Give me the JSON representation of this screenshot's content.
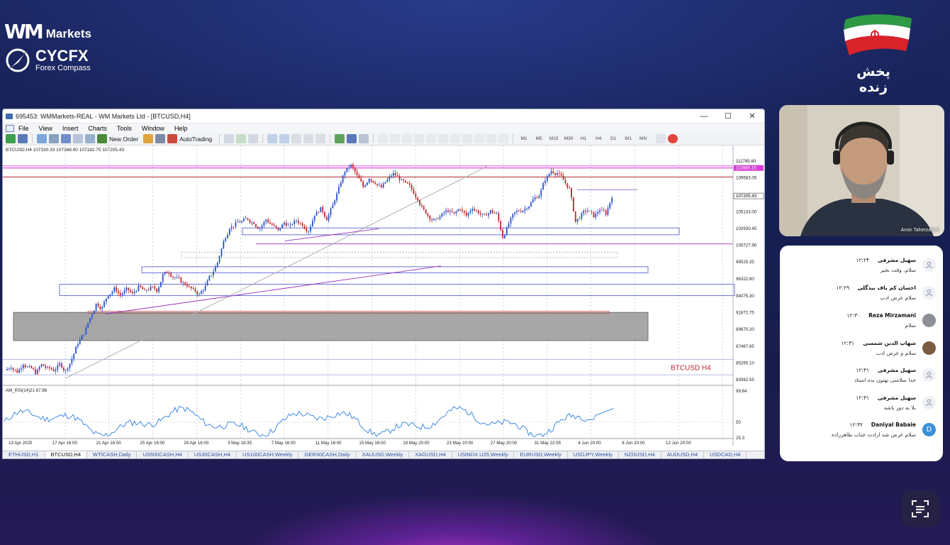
{
  "brand": {
    "wm_logo": "WM",
    "wm_markets": "Markets",
    "cycfx_title": "CYCFX",
    "cycfx_subtitle": "Forex Compass"
  },
  "live_label": "پخش زنده",
  "terminal": {
    "title": "695453: WMMarkets-REAL - WM Markets Ltd - [BTCUSD,H4]",
    "menu": [
      "File",
      "View",
      "Insert",
      "Charts",
      "Tools",
      "Window",
      "Help"
    ],
    "toolbar": {
      "new_order": "New Order",
      "autotrading": "AutoTrading",
      "timeframes": [
        "M1",
        "M5",
        "M15",
        "M30",
        "H1",
        "H4",
        "D1",
        "W1",
        "MN"
      ]
    },
    "chart_header": "BTCUSD,H4  107330.33 107368.90 107182.75 107205.43",
    "symbol_label": "BTCUSD H4",
    "rsi_label": "AM_RSI(14)21 67.98",
    "tabs": [
      "ETHUSD,H1",
      "BTCUSD,H4",
      "WTICASH,Daily",
      "US500CASH,H4",
      "US30CASH,H4",
      "US100CASH,Weekly",
      "GER30CASH,Daily",
      "XAUUSD,Weekly",
      "XAGUSD,H4",
      "USINDX.U25,Weekly",
      "EURUSD,Weekly",
      "USDJPY,Weekly",
      "NZDUSD,H4",
      "AUDUSD,H4",
      "USDCAD,H4"
    ],
    "active_tab": "BTCUSD,H4"
  },
  "chart_data": {
    "type": "candlestick",
    "symbol": "BTCUSD",
    "timeframe": "H4",
    "y_ticks": [
      111785.6,
      109583.05,
      107205.43,
      105133.0,
      102930.45,
      100727.9,
      98525.35,
      96322.8,
      94075.3,
      91872.75,
      89670.2,
      87467.65,
      85265.1,
      83062.55
    ],
    "current_price": 107205.43,
    "highlight_price": 110880.15,
    "x_ticks": [
      "13 Apr 2025",
      "17 Apr 16:00",
      "21 Apr 16:00",
      "25 Apr 16:00",
      "29 Apr 16:00",
      "3 May 18:35",
      "7 May 16:00",
      "11 May 16:00",
      "15 May 16:00",
      "19 May 20:00",
      "23 May 20:00",
      "27 May 20:00",
      "31 May 22:55",
      "4 Jun 20:00",
      "8 Jun 20:00",
      "12 Jun 20:00"
    ],
    "price_path": [
      84300,
      84800,
      84100,
      85200,
      84600,
      84000,
      85000,
      84500,
      84300,
      85100,
      84200,
      85800,
      87900,
      89200,
      91200,
      93000,
      92500,
      94300,
      95000,
      94200,
      94900,
      94300,
      95200,
      94600,
      95100,
      94800,
      96800,
      97200,
      96500,
      96000,
      95500,
      94800,
      94200,
      95300,
      96900,
      98500,
      101200,
      103100,
      103500,
      103800,
      104200,
      103700,
      103000,
      104100,
      103400,
      102600,
      103700,
      103200,
      104000,
      103500,
      102700,
      104800,
      105500,
      104200,
      106000,
      108200,
      110500,
      111200,
      109800,
      108400,
      109600,
      109000,
      108300,
      109300,
      110100,
      109500,
      108800,
      108100,
      106900,
      105300,
      104400,
      104000,
      104700,
      105300,
      104800,
      105600,
      104600,
      105700,
      105100,
      104500,
      105200,
      104800,
      101800,
      103600,
      105000,
      105300,
      105800,
      106700,
      107300,
      109400,
      110500,
      110200,
      109300,
      108100,
      103800,
      104700,
      105300,
      104600,
      105400,
      104900,
      107200
    ],
    "rsi": {
      "name": "AM_RSI(14)21",
      "last": 67.98,
      "levels": [
        99.64,
        50,
        25.3
      ]
    },
    "price_path_note": "approx closes"
  },
  "presenter": {
    "name": "Amin Taherzadeh"
  },
  "chat": [
    {
      "user": "سهیل مشرفی",
      "time": "۱۲:۲۴",
      "text": "سلام، وقت بخیر",
      "avatar": "default"
    },
    {
      "user": "احسان کم باف بیدگلی",
      "time": "۱۲:۲۹",
      "text": "سلام عرض ادب",
      "avatar": "default"
    },
    {
      "user": "Reza Mirzamani",
      "time": "۱۲:۳۰",
      "text": "سلام",
      "avatar": "photo"
    },
    {
      "user": "شهاب الدین شمسی",
      "time": "۱۲:۳۱",
      "text": "سلام و عرض ادب",
      "avatar": "photo2"
    },
    {
      "user": "سهیل مشرفی",
      "time": "۱۲:۳۱",
      "text": "خدا سلامتی بهتون بده استاد",
      "avatar": "default"
    },
    {
      "user": "سهیل مشرفی",
      "time": "۱۲:۳۱",
      "text": "بلا به دور باشه",
      "avatar": "default"
    },
    {
      "user": "Daniyal Babaie",
      "time": "۱۲:۳۲",
      "text": "سلام عرض شد ارادت جناب طاهرزاده",
      "avatar": "D"
    }
  ],
  "colors": {
    "accent": "#d63fd6",
    "bull": "#2a52c8",
    "bear": "#c1262e",
    "support_box": "#4a4fd0"
  }
}
